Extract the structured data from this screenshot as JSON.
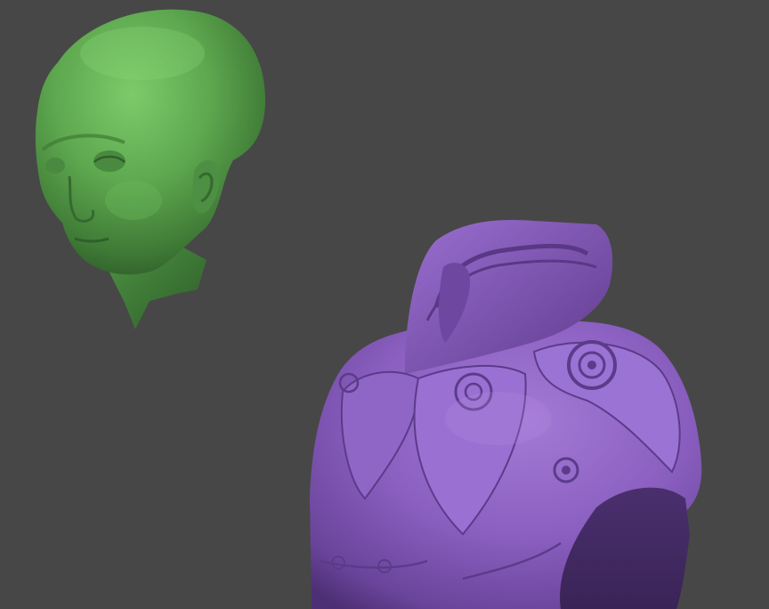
{
  "viewport": {
    "background": "#474747"
  },
  "models": [
    {
      "name": "alien-head",
      "material_color": "#59a84e"
    },
    {
      "name": "armored-torso",
      "material_color": "#8a5fc0"
    }
  ]
}
